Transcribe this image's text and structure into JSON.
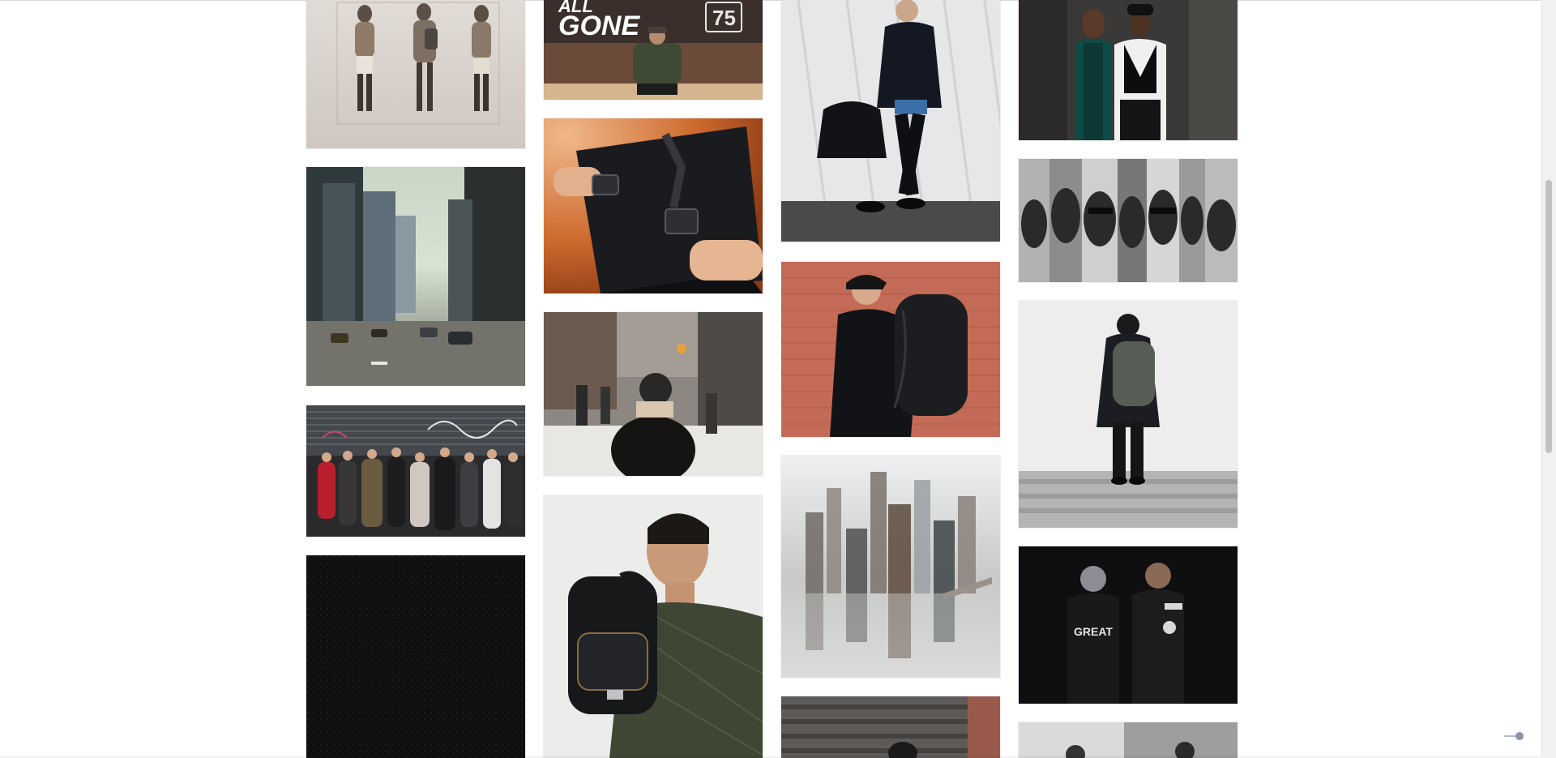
{
  "page": {
    "type": "masonry-image-gallery",
    "scroll_progress": 0.24
  },
  "colors": {
    "background": "#ffffff",
    "scroll_thumb": "#c1c1c1",
    "scroll_track": "#f1f1f1"
  },
  "gallery": {
    "columns": [
      {
        "items": [
          {
            "subject": "three hooded figures in motion, neutral backdrop"
          },
          {
            "subject": "painted city street with traffic"
          },
          {
            "subject": "crowd in front of graffiti shutter"
          },
          {
            "subject": "black leather texture"
          }
        ]
      },
      {
        "items": [
          {
            "subject": "man seated in shop window with ALL GONE sign",
            "visible_text": [
              "ALL",
              "GONE",
              "75"
            ]
          },
          {
            "subject": "hands with black backpack strap buckle"
          },
          {
            "subject": "person in beanie walking snowy street"
          },
          {
            "subject": "man with black backpack and green quilted jacket"
          }
        ]
      },
      {
        "items": [
          {
            "subject": "man in black jacket carrying duffle bag"
          },
          {
            "subject": "man with black backpack against red brick wall"
          },
          {
            "subject": "abstract painting of city skyline reflection"
          },
          {
            "subject": "figure on steps, partially visible"
          }
        ]
      },
      {
        "items": [
          {
            "subject": "couple posing in dark street clothes"
          },
          {
            "subject": "black and white portrait collage"
          },
          {
            "subject": "person in black coat with grey backpack, back view"
          },
          {
            "subject": "two people in black jackets on dark backdrop",
            "visible_text": [
              "GREAT"
            ]
          },
          {
            "subject": "black and white street photo, partially visible"
          }
        ]
      }
    ]
  }
}
